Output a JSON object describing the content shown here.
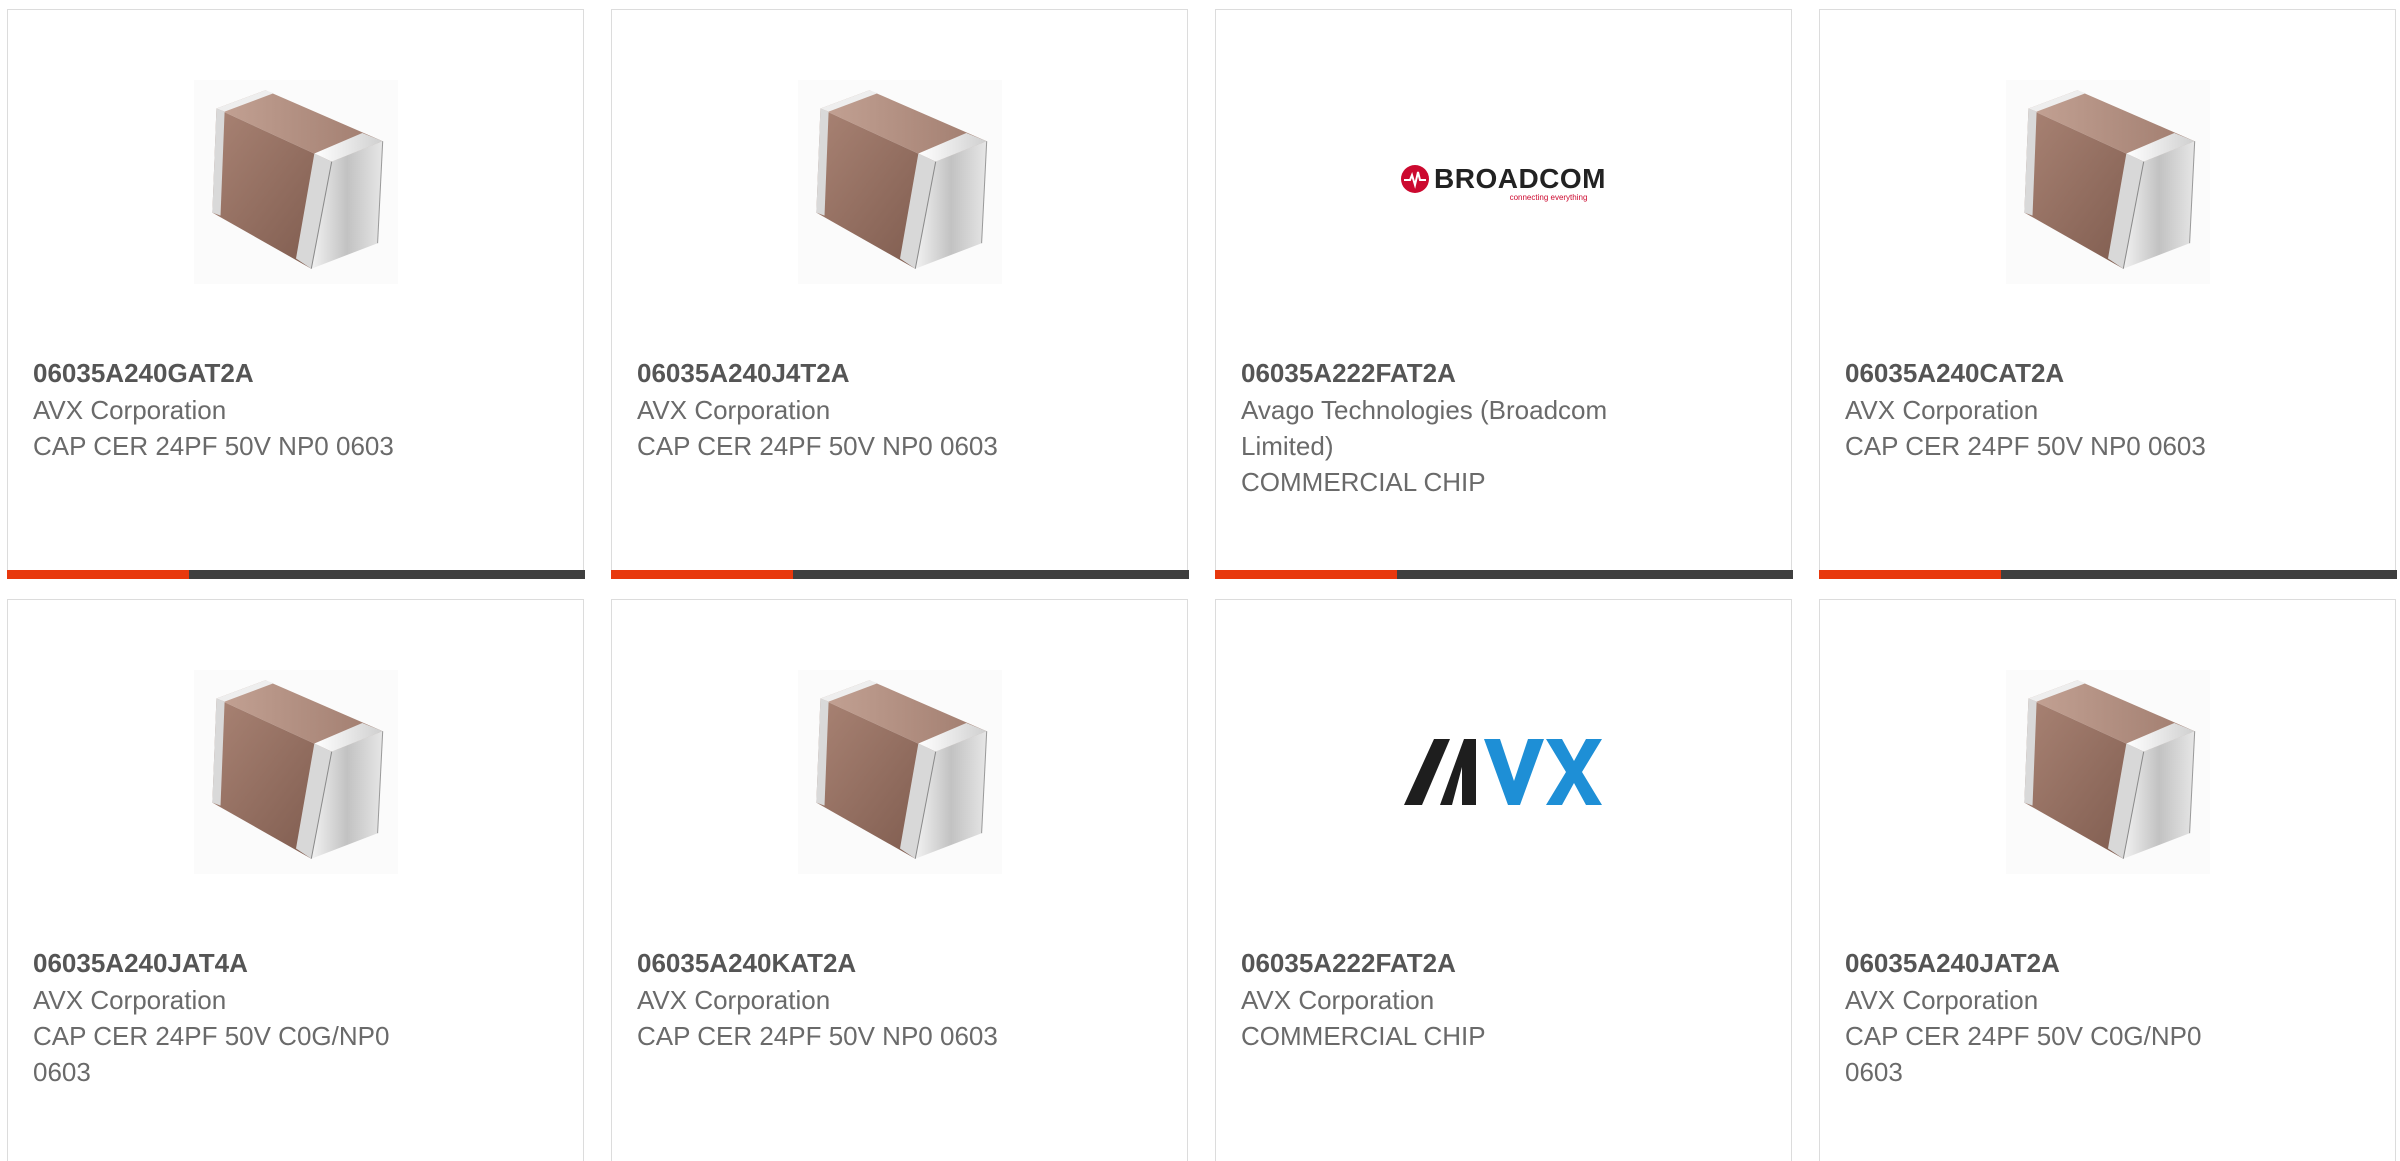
{
  "colors": {
    "accent": "#e8380d",
    "bar": "#3f3f3f",
    "border": "#dcdcdc",
    "text": "#6a6a6a",
    "part_text": "#555555"
  },
  "products": [
    {
      "image": "capacitor-chip-image",
      "part_number": "06035A240GAT2A",
      "manufacturer": "AVX Corporation",
      "description": "CAP CER 24PF 50V NP0 0603"
    },
    {
      "image": "capacitor-chip-image",
      "part_number": "06035A240J4T2A",
      "manufacturer": "AVX Corporation",
      "description": "CAP CER 24PF 50V NP0 0603"
    },
    {
      "image": "broadcom-logo",
      "logo_text": "BROADCOM",
      "logo_tagline": "connecting everything",
      "part_number": "06035A222FAT2A",
      "manufacturer": "Avago Technologies (Broadcom Limited)",
      "description": "COMMERCIAL CHIP"
    },
    {
      "image": "capacitor-chip-image",
      "part_number": "06035A240CAT2A",
      "manufacturer": "AVX Corporation",
      "description": "CAP CER 24PF 50V NP0 0603"
    },
    {
      "image": "capacitor-chip-image",
      "part_number": "06035A240JAT4A",
      "manufacturer": "AVX Corporation",
      "description": "CAP CER 24PF 50V C0G/NP0 0603"
    },
    {
      "image": "capacitor-chip-image",
      "part_number": "06035A240KAT2A",
      "manufacturer": "AVX Corporation",
      "description": "CAP CER 24PF 50V NP0 0603"
    },
    {
      "image": "avx-logo",
      "logo_text": "AVX",
      "part_number": "06035A222FAT2A",
      "manufacturer": "AVX Corporation",
      "description": "COMMERCIAL CHIP"
    },
    {
      "image": "capacitor-chip-image",
      "part_number": "06035A240JAT2A",
      "manufacturer": "AVX Corporation",
      "description": "CAP CER 24PF 50V C0G/NP0 0603"
    }
  ]
}
